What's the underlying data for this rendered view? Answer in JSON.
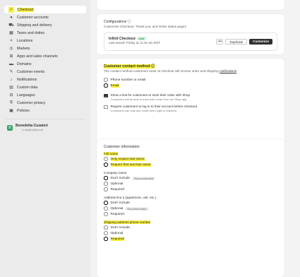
{
  "sidebar": {
    "items": [
      {
        "icon": "✓",
        "label": "Checkout"
      },
      {
        "icon": "●",
        "label": "Customer accounts"
      },
      {
        "icon": "⛟",
        "label": "Shipping and delivery"
      },
      {
        "icon": "▦",
        "label": "Taxes and duties"
      },
      {
        "icon": "⌖",
        "label": "Locations"
      },
      {
        "icon": "◎",
        "label": "Markets"
      },
      {
        "icon": "⊞",
        "label": "Apps and sales channels"
      },
      {
        "icon": "▬",
        "label": "Domains"
      },
      {
        "icon": "✎",
        "label": "Customer events"
      },
      {
        "icon": "♪",
        "label": "Notifications"
      },
      {
        "icon": "▤",
        "label": "Custom data"
      },
      {
        "icon": "⊟",
        "label": "Languages"
      },
      {
        "icon": "⛨",
        "label": "Customer privacy"
      },
      {
        "icon": "▣",
        "label": "Policies"
      }
    ],
    "store": {
      "initial": "B",
      "name": "Benedetta Cusatori",
      "domain": "b.myshopify.com"
    }
  },
  "config": {
    "title": "Configurations ⓘ",
    "desc": "Customize Checkout, Thank you, and Order status pages",
    "name": "Infinit Checkout",
    "badge": "Live",
    "saved": "Last saved: Friday at 11:42 am EDT",
    "dots": "•••",
    "duplicate": "Duplicate",
    "customize": "Customize"
  },
  "contact": {
    "title": "Customer contact method ⓘ",
    "desc_pre": "The contact method customers enter at checkout will receive order and shipping ",
    "desc_link": "notifications",
    "options": [
      "Phone number or email",
      "Email"
    ],
    "check1": "Show a link for customers to track their order with Shop",
    "check1_sub": "Customers will be able to track their order from the Shop app.",
    "check2": "Require customers to log in to their account before checkout",
    "check2_sub": "Customers can only use email when login is required"
  },
  "info": {
    "title": "Customer information",
    "fullname": {
      "label": "Full name",
      "options": [
        "Only require last name",
        "Require first and last name"
      ]
    },
    "company": {
      "label": "Company name",
      "options": [
        "Don't include",
        "Optional",
        "Required"
      ],
      "rec": "Recommended"
    },
    "address2": {
      "label": "Address line 2 (apartment, unit, etc.)",
      "options": [
        "Don't include",
        "Optional",
        "Required"
      ],
      "rec": "Recommended"
    },
    "phone": {
      "label": "Shipping address phone number",
      "options": [
        "Don't include",
        "Optional",
        "Required"
      ]
    }
  },
  "colors": {
    "highlight": "#f6ef3a",
    "live_badge": "#cdf0d4",
    "primary_button": "#303030"
  }
}
